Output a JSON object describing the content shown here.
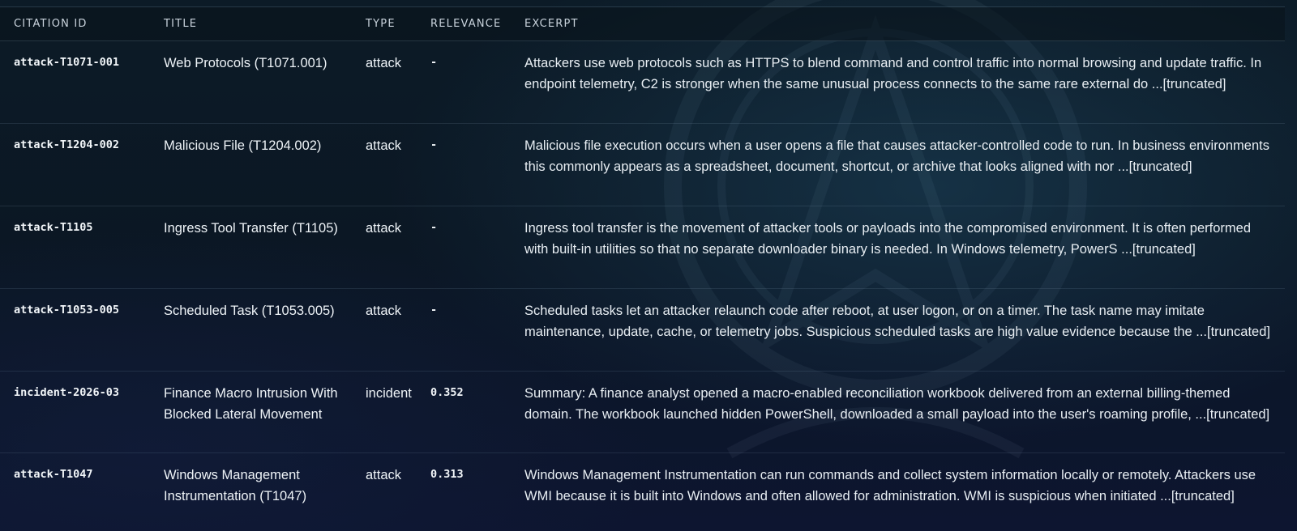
{
  "table": {
    "columns": [
      "CITATION ID",
      "TITLE",
      "TYPE",
      "RELEVANCE",
      "EXCERPT"
    ],
    "rows": [
      {
        "citation_id": "attack-T1071-001",
        "title": "Web Protocols (T1071.001)",
        "type": "attack",
        "relevance": "-",
        "excerpt": "Attackers use web protocols such as HTTPS to blend command and control traffic into normal browsing and update traffic. In endpoint telemetry, C2 is stronger when the same unusual process connects to the same rare external do ...[truncated]"
      },
      {
        "citation_id": "attack-T1204-002",
        "title": "Malicious File (T1204.002)",
        "type": "attack",
        "relevance": "-",
        "excerpt": "Malicious file execution occurs when a user opens a file that causes attacker-controlled code to run. In business environments this commonly appears as a spreadsheet, document, shortcut, or archive that looks aligned with nor ...[truncated]"
      },
      {
        "citation_id": "attack-T1105",
        "title": "Ingress Tool Transfer (T1105)",
        "type": "attack",
        "relevance": "-",
        "excerpt": "Ingress tool transfer is the movement of attacker tools or payloads into the compromised environment. It is often performed with built-in utilities so that no separate downloader binary is needed. In Windows telemetry, PowerS ...[truncated]"
      },
      {
        "citation_id": "attack-T1053-005",
        "title": "Scheduled Task (T1053.005)",
        "type": "attack",
        "relevance": "-",
        "excerpt": "Scheduled tasks let an attacker relaunch code after reboot, at user logon, or on a timer. The task name may imitate maintenance, update, cache, or telemetry jobs. Suspicious scheduled tasks are high value evidence because the ...[truncated]"
      },
      {
        "citation_id": "incident-2026-03",
        "title": "Finance Macro Intrusion With Blocked Lateral Movement",
        "type": "incident",
        "relevance": "0.352",
        "excerpt": "Summary: A finance analyst opened a macro-enabled reconciliation workbook delivered from an external billing-themed domain. The workbook launched hidden PowerShell, downloaded a small payload into the user's roaming profile, ...[truncated]"
      },
      {
        "citation_id": "attack-T1047",
        "title": "Windows Management Instrumentation (T1047)",
        "type": "attack",
        "relevance": "0.313",
        "excerpt": "Windows Management Instrumentation can run commands and collect system information locally or remotely. Attackers use WMI because it is built into Windows and often allowed for administration. WMI is suspicious when initiated ...[truncated]"
      }
    ]
  }
}
